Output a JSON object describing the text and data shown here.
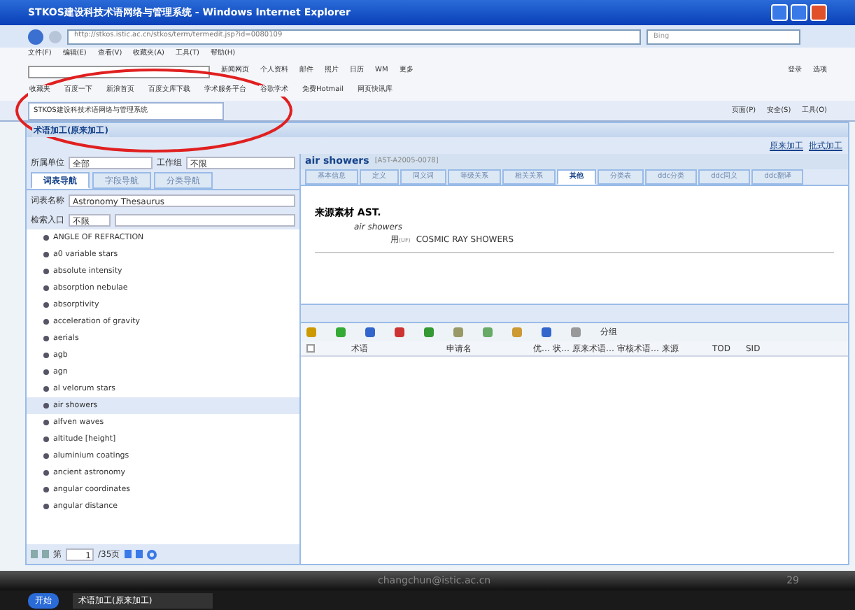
{
  "window": {
    "title": "STKOS建设科技术语网络与管理系统 - Windows Internet Explorer"
  },
  "address_bar": {
    "url": "http://stkos.istic.ac.cn/stkos/term/termedit.jsp?id=0080109",
    "search_placeholder": "Bing"
  },
  "menu": [
    "文件(F)",
    "编辑(E)",
    "查看(V)",
    "收藏夹(A)",
    "工具(T)",
    "帮助(H)"
  ],
  "google_bar": {
    "items": [
      "新闻网页",
      "个人资料",
      "邮件",
      "照片",
      "日历",
      "WM",
      "更多"
    ],
    "right": [
      "登录",
      "选项"
    ]
  },
  "favorites": [
    "收藏夹",
    "百度一下",
    "新浪首页",
    "百度文库下载",
    "学术服务平台",
    "谷歌学术",
    "免费Hotmail",
    "网页快讯库"
  ],
  "browser_tab": {
    "title": "STKOS建设科技术语网络与管理系统",
    "selected": true
  },
  "command_bar": [
    "页面(P)",
    "安全(S)",
    "工具(O)"
  ],
  "app": {
    "title": "术语加工(原来加工)",
    "links": [
      "原来加工",
      "批式加工"
    ],
    "filters": [
      {
        "label": "所属单位",
        "value": "全部"
      },
      {
        "label": "工作组",
        "value": "不限"
      }
    ],
    "nav_tabs": [
      {
        "label": "词表导航",
        "selected": true
      },
      {
        "label": "字段导航",
        "selected": false
      },
      {
        "label": "分类导航",
        "selected": false
      }
    ],
    "thesaurus": {
      "label": "词表名称",
      "value": "Astronomy Thesaurus"
    },
    "search": {
      "label": "检索入口",
      "value": "不限"
    },
    "terms": [
      {
        "text": "ANGLE OF REFRACTION",
        "selected": false
      },
      {
        "text": "a0 variable stars",
        "selected": false
      },
      {
        "text": "absolute intensity",
        "selected": false
      },
      {
        "text": "absorption nebulae",
        "selected": false
      },
      {
        "text": "absorptivity",
        "selected": false
      },
      {
        "text": "acceleration of gravity",
        "selected": false
      },
      {
        "text": "aerials",
        "selected": false
      },
      {
        "text": "agb",
        "selected": false
      },
      {
        "text": "agn",
        "selected": false
      },
      {
        "text": "al velorum stars",
        "selected": false
      },
      {
        "text": "air showers",
        "selected": true
      },
      {
        "text": "alfven waves",
        "selected": false
      },
      {
        "text": "altitude [height]",
        "selected": false
      },
      {
        "text": "aluminium coatings",
        "selected": false
      },
      {
        "text": "ancient astronomy",
        "selected": false
      },
      {
        "text": "angular coordinates",
        "selected": false
      },
      {
        "text": "angular distance",
        "selected": false
      }
    ],
    "pager": {
      "prefix": "第",
      "page": "1",
      "total": "/35页"
    },
    "detail": {
      "term": "air showers",
      "code": "[AST-A2005-0078]",
      "tabs": [
        {
          "label": "基本信息",
          "selected": false
        },
        {
          "label": "定义",
          "selected": false
        },
        {
          "label": "同义词",
          "selected": false
        },
        {
          "label": "等级关系",
          "selected": false
        },
        {
          "label": "相关关系",
          "selected": false
        },
        {
          "label": "其他",
          "selected": true
        },
        {
          "label": "分类表",
          "selected": false
        },
        {
          "label": "ddc分类",
          "selected": false
        },
        {
          "label": "ddc同义",
          "selected": false
        },
        {
          "label": "ddc翻译",
          "selected": false
        }
      ],
      "source": "来源素材 AST.",
      "entry": "air showers",
      "use_label": "用",
      "use_tag": "(UF)",
      "use_value": "COSMIC RAY SHOWERS"
    },
    "grid_toolbar": {
      "group": "分组"
    },
    "select_all": {
      "checked": false
    },
    "grid_columns": [
      "术语",
      "申请名",
      "优…",
      "状…",
      "原来术语…",
      "审核术语…",
      "来源",
      "TOD",
      "SID"
    ]
  },
  "footer": {
    "email": "changchun@istic.ac.cn",
    "page": "29"
  },
  "taskbar": {
    "start": "开始",
    "task": "术语加工(原来加工)"
  }
}
